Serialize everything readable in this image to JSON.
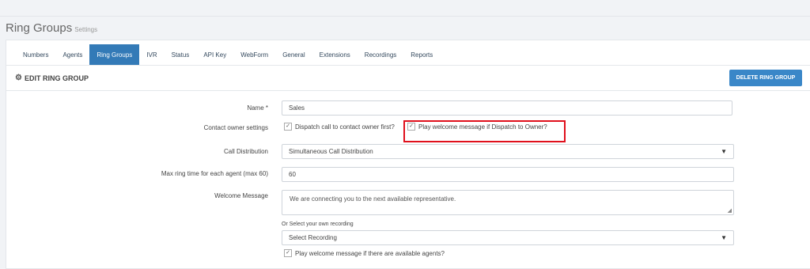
{
  "header": {
    "title": "Ring Groups",
    "subtitle": "Settings"
  },
  "tabs": [
    {
      "label": "Numbers"
    },
    {
      "label": "Agents"
    },
    {
      "label": "Ring Groups"
    },
    {
      "label": "IVR"
    },
    {
      "label": "Status"
    },
    {
      "label": "API Key"
    },
    {
      "label": "WebForm"
    },
    {
      "label": "General"
    },
    {
      "label": "Extensions"
    },
    {
      "label": "Recordings"
    },
    {
      "label": "Reports"
    }
  ],
  "active_tab": "Ring Groups",
  "section": {
    "title": "EDIT RING GROUP",
    "delete_label": "DELETE RING GROUP"
  },
  "form": {
    "name_label": "Name *",
    "name_value": "Sales",
    "contact_owner_label": "Contact owner settings",
    "dispatch_label": "Dispatch call to contact owner first?",
    "play_welcome_owner_label": "Play welcome message if Dispatch to Owner?",
    "call_distribution_label": "Call Distribution",
    "call_distribution_value": "Simultaneous Call Distribution",
    "max_ring_label": "Max ring time for each agent (max 60)",
    "max_ring_value": "60",
    "welcome_label": "Welcome Message",
    "welcome_value": "We are connecting you to the next available representative.",
    "or_select_label": "Or Select your own recording",
    "recording_value": "Select Recording",
    "play_welcome_agents_label": "Play welcome message if there are available agents?"
  },
  "colors": {
    "accent": "#337ab7",
    "highlight": "#e0101c"
  }
}
